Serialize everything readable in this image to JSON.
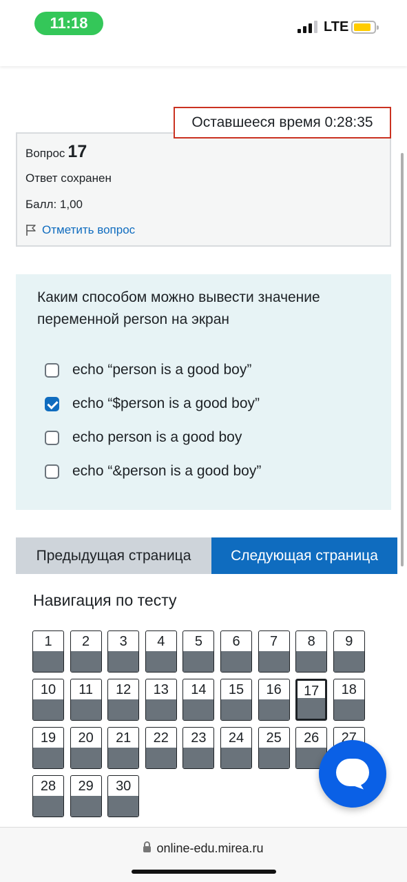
{
  "status_bar": {
    "time": "11:18",
    "network": "LTE",
    "accent_color": "#34c759",
    "battery_color": "#ffcc00",
    "signal_bars": 3,
    "signal_bars_total": 4
  },
  "timer": {
    "text": "Оставшееся время 0:28:35"
  },
  "info": {
    "question_label": "Вопрос",
    "question_number": "17",
    "state": "Ответ сохранен",
    "grade": "Балл: 1,00",
    "flag_label": "Отметить вопрос",
    "flag_icon": "flag-icon"
  },
  "question": {
    "text": "Каким способом можно вывести значение переменной person на экран",
    "options": [
      {
        "label": "echo “person is a good boy”",
        "checked": false
      },
      {
        "label": "echo “$person is a good boy”",
        "checked": true
      },
      {
        "label": "echo person is a good boy",
        "checked": false
      },
      {
        "label": "echo “&person is a good boy”",
        "checked": false
      }
    ]
  },
  "navigation_buttons": {
    "prev_label": "Предыдущая страница",
    "next_label": "Следующая страница"
  },
  "quiz_nav": {
    "title": "Навигация по тесту",
    "current": 17,
    "questions": [
      "1",
      "2",
      "3",
      "4",
      "5",
      "6",
      "7",
      "8",
      "9",
      "10",
      "11",
      "12",
      "13",
      "14",
      "15",
      "16",
      "17",
      "18",
      "19",
      "20",
      "21",
      "22",
      "23",
      "24",
      "25",
      "26",
      "27",
      "28",
      "29",
      "30"
    ]
  },
  "chat": {
    "icon": "chat-bubble-icon"
  },
  "browser": {
    "url": "online-edu.mirea.ru",
    "lock_icon": "lock-icon"
  },
  "colors": {
    "primary": "#0f6cbf",
    "timer_border": "#ca3120",
    "question_bg": "#e7f3f5",
    "answered_bar": "#6a737b",
    "chat_fab": "#0a60e6"
  }
}
